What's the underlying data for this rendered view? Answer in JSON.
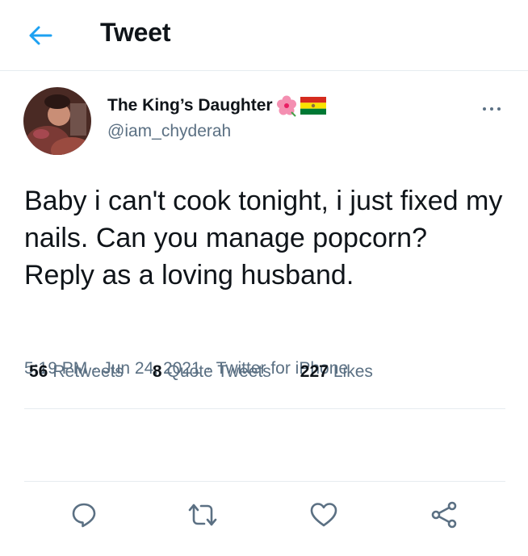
{
  "header": {
    "title": "Tweet",
    "back_icon": "arrow-left-icon"
  },
  "tweet": {
    "author": {
      "display_name": "The King’s Daughter",
      "handle": "@iam_chyderah",
      "name_emojis": [
        "hibiscus-flower-icon",
        "bolivia-flag-icon"
      ]
    },
    "text": "Baby i can't cook tonight, i just fixed my nails. Can you manage popcorn?\nReply as a loving husband.",
    "time": "5:19 PM",
    "date": "Jun 24, 2021",
    "source": "Twitter for iPhone",
    "separator": "·"
  },
  "stats": {
    "retweets": {
      "count": "56",
      "label": "Retweets"
    },
    "quotes": {
      "count": "8",
      "label": "Quote Tweets"
    },
    "likes": {
      "count": "227",
      "label": "Likes"
    }
  },
  "colors": {
    "accent": "#1da1f2",
    "text_primary": "#0f1419",
    "text_secondary": "#5b7083",
    "divider": "#e6ecf0"
  }
}
